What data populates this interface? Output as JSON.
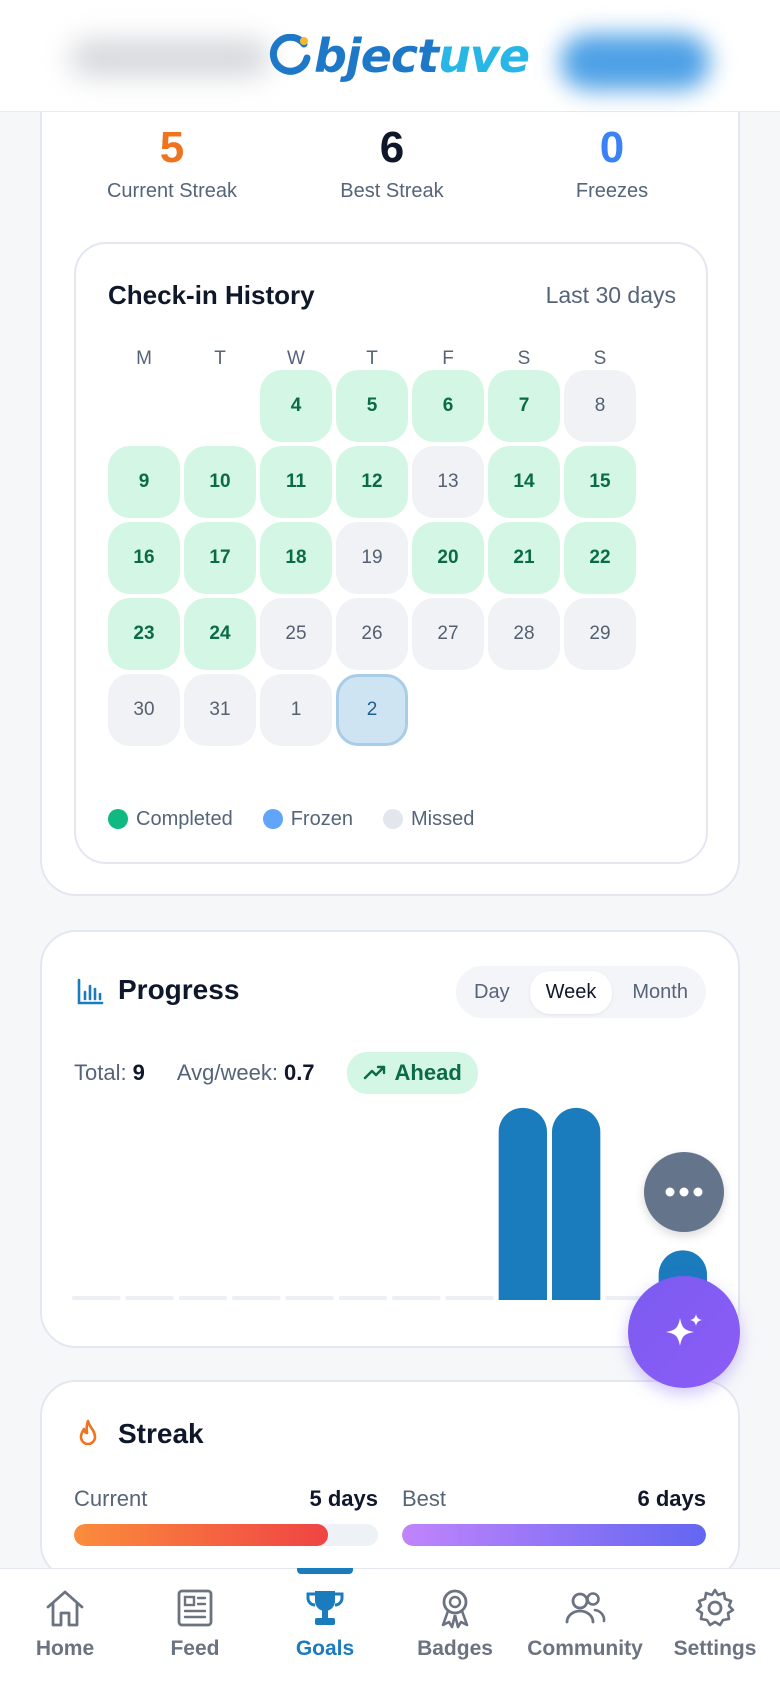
{
  "header": {
    "brand": "Objectuve",
    "brand_initial_mark": "O",
    "brand_rest": "bject",
    "brand_tail": "uve"
  },
  "stats": [
    {
      "value": "5",
      "label": "Current Streak",
      "color": "#f07420"
    },
    {
      "value": "6",
      "label": "Best Streak",
      "color": "#0f172a"
    },
    {
      "value": "0",
      "label": "Freezes",
      "color": "#3b82f6"
    }
  ],
  "history": {
    "title": "Check-in History",
    "range": "Last 30 days",
    "weekdays": [
      "M",
      "T",
      "W",
      "T",
      "F",
      "S",
      "S"
    ],
    "days": [
      {
        "d": "4",
        "s": "completed"
      },
      {
        "d": "5",
        "s": "completed"
      },
      {
        "d": "6",
        "s": "completed"
      },
      {
        "d": "7",
        "s": "completed"
      },
      {
        "d": "8",
        "s": "missed"
      },
      {
        "d": "9",
        "s": "completed"
      },
      {
        "d": "10",
        "s": "completed"
      },
      {
        "d": "11",
        "s": "completed"
      },
      {
        "d": "12",
        "s": "completed"
      },
      {
        "d": "13",
        "s": "missed"
      },
      {
        "d": "14",
        "s": "completed"
      },
      {
        "d": "15",
        "s": "completed"
      },
      {
        "d": "16",
        "s": "completed"
      },
      {
        "d": "17",
        "s": "completed"
      },
      {
        "d": "18",
        "s": "completed"
      },
      {
        "d": "19",
        "s": "missed"
      },
      {
        "d": "20",
        "s": "completed"
      },
      {
        "d": "21",
        "s": "completed"
      },
      {
        "d": "22",
        "s": "completed"
      },
      {
        "d": "23",
        "s": "completed"
      },
      {
        "d": "24",
        "s": "completed"
      },
      {
        "d": "25",
        "s": "missed"
      },
      {
        "d": "26",
        "s": "missed"
      },
      {
        "d": "27",
        "s": "missed"
      },
      {
        "d": "28",
        "s": "missed"
      },
      {
        "d": "29",
        "s": "missed"
      },
      {
        "d": "30",
        "s": "missed"
      },
      {
        "d": "31",
        "s": "missed"
      },
      {
        "d": "1",
        "s": "missed"
      },
      {
        "d": "2",
        "s": "today"
      }
    ],
    "first_weekday_index": 2,
    "legend": [
      {
        "label": "Completed",
        "color": "#10b981"
      },
      {
        "label": "Frozen",
        "color": "#60a5fa"
      },
      {
        "label": "Missed",
        "color": "#e2e6ed"
      }
    ]
  },
  "progress": {
    "title": "Progress",
    "periods": [
      "Day",
      "Week",
      "Month"
    ],
    "active_period": "Week",
    "total_label": "Total:",
    "total_value": "9",
    "avg_label": "Avg/week:",
    "avg_value": "0.7",
    "status": "Ahead"
  },
  "chart_data": {
    "type": "bar",
    "values": [
      0,
      0,
      0,
      0,
      0,
      0,
      0,
      0,
      4,
      4,
      0,
      1
    ],
    "ylim": [
      0,
      4
    ]
  },
  "streak": {
    "title": "Streak",
    "current_label": "Current",
    "current_value": "5 days",
    "current_fraction": 0.835,
    "best_label": "Best",
    "best_value": "6 days",
    "best_fraction": 1.0
  },
  "nav": [
    {
      "label": "Home",
      "icon": "home-icon"
    },
    {
      "label": "Feed",
      "icon": "newspaper-icon"
    },
    {
      "label": "Goals",
      "icon": "trophy-icon",
      "active": true
    },
    {
      "label": "Badges",
      "icon": "badge-icon"
    },
    {
      "label": "Community",
      "icon": "users-icon"
    },
    {
      "label": "Settings",
      "icon": "gear-icon"
    }
  ],
  "colors": {
    "accent": "#1a7bbd",
    "completed_bg": "#d4f7e5",
    "missed_bg": "#f0f2f6",
    "ai_fab": "#7c5cf0"
  }
}
